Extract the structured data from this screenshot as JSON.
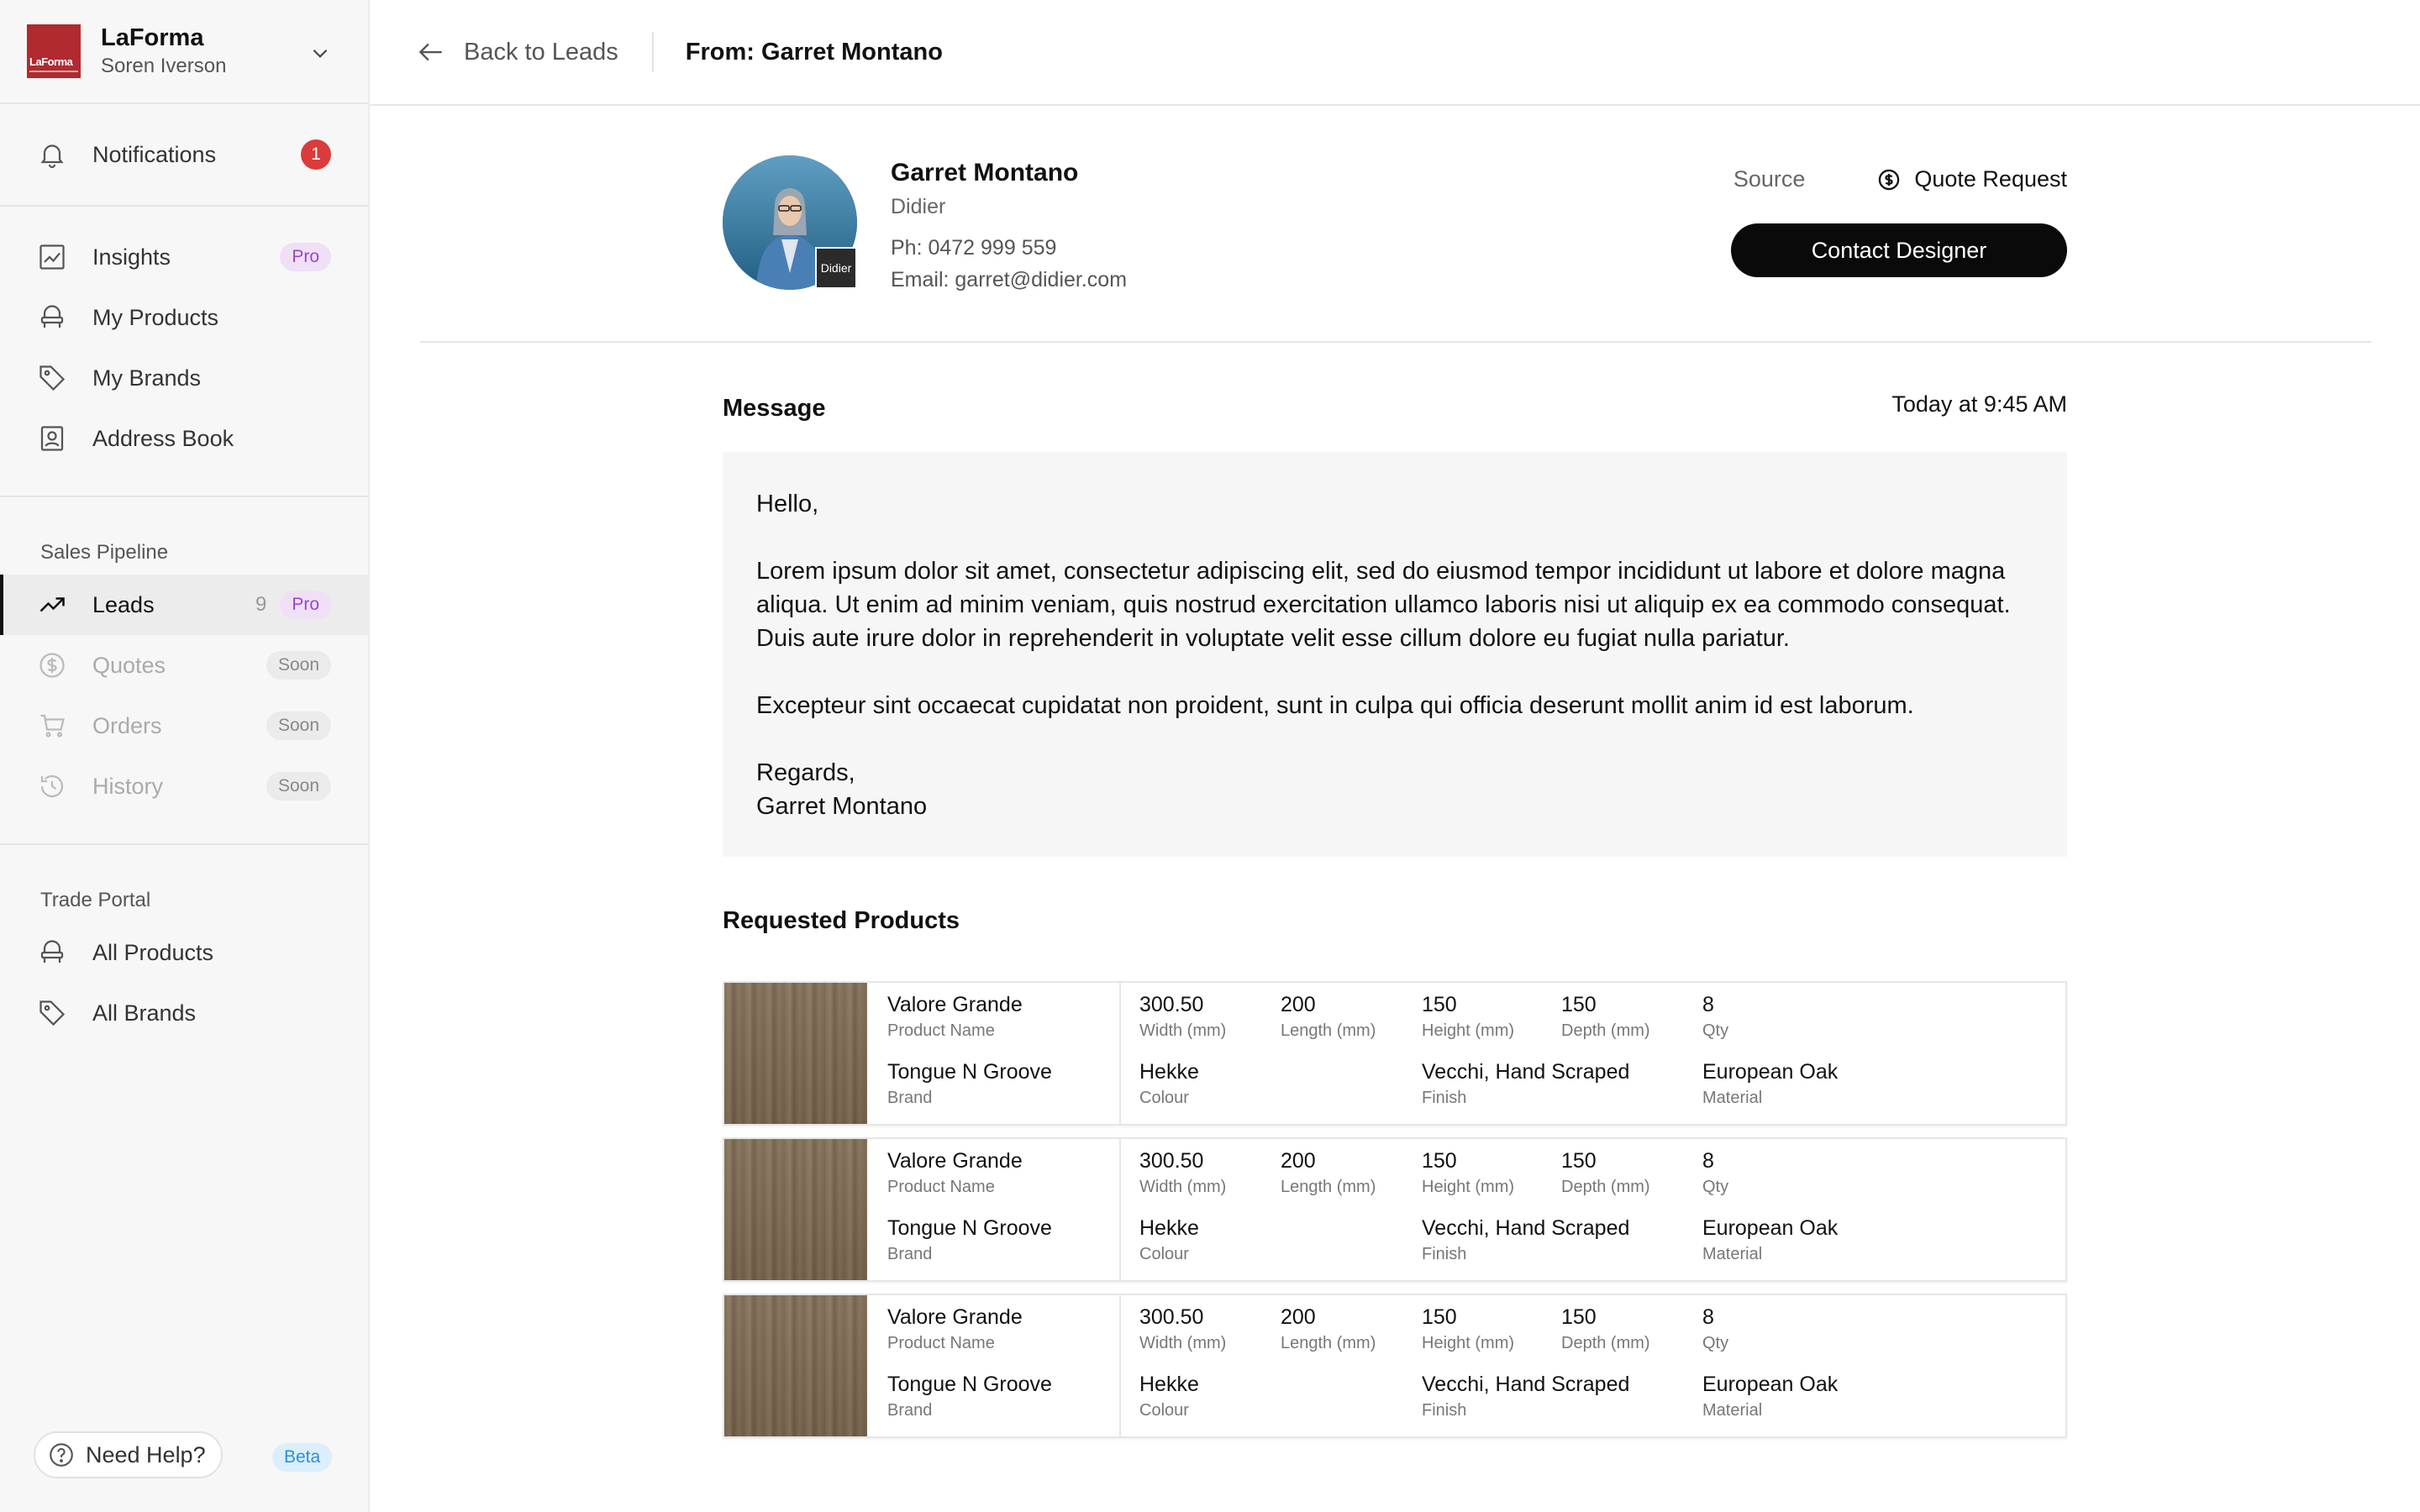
{
  "sidebar": {
    "brand_name": "LaForma",
    "brand_logo_text": "LaForma",
    "user_name": "Soren Iverson",
    "notifications": {
      "label": "Notifications",
      "count": "1"
    },
    "items": [
      {
        "label": "Insights",
        "pill": "Pro"
      },
      {
        "label": "My Products"
      },
      {
        "label": "My Brands"
      },
      {
        "label": "Address Book"
      }
    ],
    "sales_pipeline": {
      "title": "Sales Pipeline",
      "items": [
        {
          "label": "Leads",
          "count": "9",
          "pill": "Pro"
        },
        {
          "label": "Quotes",
          "pill": "Soon"
        },
        {
          "label": "Orders",
          "pill": "Soon"
        },
        {
          "label": "History",
          "pill": "Soon"
        }
      ]
    },
    "trade_portal": {
      "title": "Trade Portal",
      "items": [
        {
          "label": "All Products"
        },
        {
          "label": "All Brands"
        }
      ]
    },
    "help": {
      "label": "Need Help?",
      "pill": "Beta"
    }
  },
  "topbar": {
    "back_label": "Back to Leads",
    "from_label": "From: Garret Montano"
  },
  "lead": {
    "name": "Garret Montano",
    "company": "Didier",
    "avatar_tag": "Didier",
    "phone": "Ph: 0472 999 559",
    "email": "Email: garret@didier.com",
    "source_label": "Source",
    "source_value": "Quote Request",
    "contact_button": "Contact Designer"
  },
  "message": {
    "title": "Message",
    "time": "Today at 9:45 AM",
    "greeting": "Hello,",
    "para1": "Lorem ipsum dolor sit amet, consectetur adipiscing elit, sed do eiusmod tempor incididunt ut labore et dolore magna aliqua. Ut enim ad minim veniam, quis nostrud exercitation ullamco laboris nisi ut aliquip ex ea commodo consequat. Duis aute irure dolor in reprehenderit in voluptate velit esse cillum dolore eu fugiat nulla pariatur.",
    "para2": "Excepteur sint occaecat cupidatat non proident, sunt in culpa qui officia deserunt mollit anim id est laborum.",
    "signoff": "Regards,",
    "signature": "Garret Montano"
  },
  "requested_products": {
    "title": "Requested Products",
    "labels": {
      "product_name": "Product Name",
      "brand": "Brand",
      "width": "Width (mm)",
      "length": "Length (mm)",
      "height": "Height (mm)",
      "depth": "Depth (mm)",
      "qty": "Qty",
      "colour": "Colour",
      "finish": "Finish",
      "material": "Material"
    },
    "rows": [
      {
        "product_name": "Valore Grande",
        "brand": "Tongue N Groove",
        "width": "300.50",
        "length": "200",
        "height": "150",
        "depth": "150",
        "qty": "8",
        "colour": "Hekke",
        "finish": "Vecchi, Hand Scraped",
        "material": "European Oak"
      },
      {
        "product_name": "Valore Grande",
        "brand": "Tongue N Groove",
        "width": "300.50",
        "length": "200",
        "height": "150",
        "depth": "150",
        "qty": "8",
        "colour": "Hekke",
        "finish": "Vecchi, Hand Scraped",
        "material": "European Oak"
      },
      {
        "product_name": "Valore Grande",
        "brand": "Tongue N Groove",
        "width": "300.50",
        "length": "200",
        "height": "150",
        "depth": "150",
        "qty": "8",
        "colour": "Hekke",
        "finish": "Vecchi, Hand Scraped",
        "material": "European Oak"
      }
    ]
  },
  "colors": {
    "brand": "#b02a30",
    "notification_badge": "#dc3b3b",
    "pro_pill": "#9b45c9",
    "beta_pill": "#2c8fd9",
    "primary_button": "#0a0a0a"
  },
  "icons": {
    "notifications": "bell-icon",
    "insights": "line-chart-icon",
    "my_products": "chair-icon",
    "my_brands": "tag-icon",
    "address_book": "contact-book-icon",
    "leads": "trending-up-icon",
    "quotes": "dollar-circle-icon",
    "orders": "cart-icon",
    "history": "history-icon",
    "help": "question-circle-icon",
    "back": "arrow-left-icon",
    "source": "dollar-circle-icon"
  }
}
